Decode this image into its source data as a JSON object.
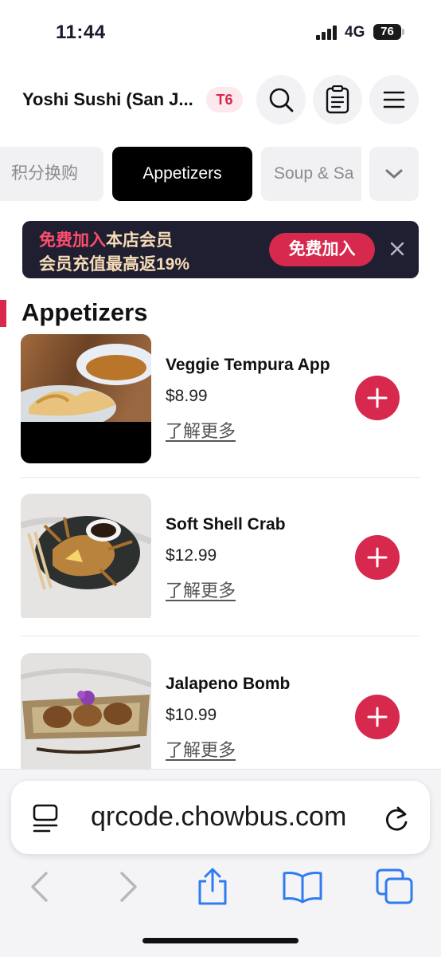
{
  "status_bar": {
    "time": "11:44",
    "network": "4G",
    "battery": "76"
  },
  "header": {
    "restaurant_name": "Yoshi Sushi (San J...",
    "table_badge": "T6",
    "icons": [
      "search-icon",
      "order-list-icon",
      "menu-icon"
    ]
  },
  "tabs": {
    "items": [
      "积分换购",
      "Appetizers",
      "Soup & Sa"
    ],
    "active": "Appetizers"
  },
  "banner": {
    "highlight": "免费加入",
    "line1_rest": "本店会员",
    "line2": "会员充值最高返19%",
    "join_label": "免费加入"
  },
  "section": {
    "title": "Appetizers"
  },
  "items": [
    {
      "name": "Veggie Tempura App",
      "price": "$8.99",
      "more": "了解更多"
    },
    {
      "name": "Soft Shell Crab",
      "price": "$12.99",
      "more": "了解更多"
    },
    {
      "name": "Jalapeno Bomb",
      "price": "$10.99",
      "more": "了解更多"
    }
  ],
  "browser": {
    "url": "qrcode.chowbus.com"
  },
  "colors": {
    "accent": "#d6294d",
    "banner_bg": "#1f1f31",
    "banner_text": "#f5dcb6"
  }
}
